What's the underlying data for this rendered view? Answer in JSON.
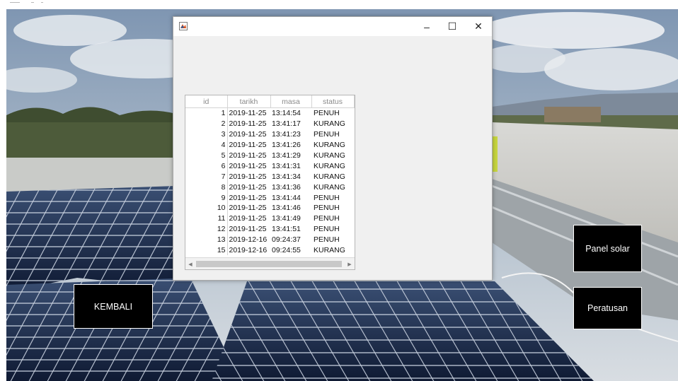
{
  "window": {
    "controls": {
      "minimize": "–",
      "maximize": "☐",
      "close": "✕"
    }
  },
  "table": {
    "columns": [
      "id",
      "tarikh",
      "masa",
      "status"
    ],
    "rows": [
      [
        "1",
        "2019-11-25",
        "13:14:54",
        "PENUH"
      ],
      [
        "2",
        "2019-11-25",
        "13:41:17",
        "KURANG"
      ],
      [
        "3",
        "2019-11-25",
        "13:41:23",
        "PENUH"
      ],
      [
        "4",
        "2019-11-25",
        "13:41:26",
        "KURANG"
      ],
      [
        "5",
        "2019-11-25",
        "13:41:29",
        "KURANG"
      ],
      [
        "6",
        "2019-11-25",
        "13:41:31",
        "KURANG"
      ],
      [
        "7",
        "2019-11-25",
        "13:41:34",
        "KURANG"
      ],
      [
        "8",
        "2019-11-25",
        "13:41:36",
        "KURANG"
      ],
      [
        "9",
        "2019-11-25",
        "13:41:44",
        "PENUH"
      ],
      [
        "10",
        "2019-11-25",
        "13:41:46",
        "PENUH"
      ],
      [
        "11",
        "2019-11-25",
        "13:41:49",
        "PENUH"
      ],
      [
        "12",
        "2019-11-25",
        "13:41:51",
        "PENUH"
      ],
      [
        "13",
        "2019-12-16",
        "09:24:37",
        "PENUH"
      ],
      [
        "15",
        "2019-12-16",
        "09:24:55",
        "KURANG"
      ]
    ],
    "scroll_left_arrow": "◀",
    "scroll_right_arrow": "▶"
  },
  "buttons": {
    "kembali": "KEMBALI",
    "panel_solar": "Panel solar",
    "peratusan": "Peratusan"
  },
  "icons": {
    "app": "figure-window-icon",
    "background": "solar-panel-rooftop-photo"
  },
  "colors": {
    "sky": "#8fa3b8",
    "panel": "#1b2a4a",
    "button_bg": "#000000",
    "button_text": "#ffffff",
    "window_bg": "#f0f0f0"
  }
}
